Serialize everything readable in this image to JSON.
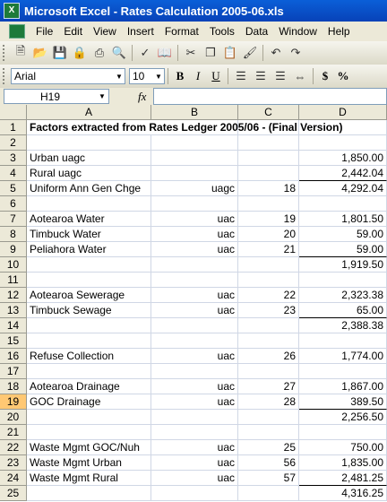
{
  "window": {
    "title": "Microsoft Excel - Rates Calculation 2005-06.xls",
    "icon_letter": "X"
  },
  "menu": [
    "File",
    "Edit",
    "View",
    "Insert",
    "Format",
    "Tools",
    "Data",
    "Window",
    "Help"
  ],
  "toolbar2": {
    "font": "Arial",
    "size": "10",
    "bold": "B",
    "italic": "I",
    "underline": "U",
    "currency": "$",
    "percent": "%"
  },
  "formula_bar": {
    "name_box": "H19",
    "fx": "fx",
    "content": ""
  },
  "columns": [
    "A",
    "B",
    "C",
    "D"
  ],
  "rows": [
    {
      "n": "1",
      "a": "Factors extracted from Rates Ledger 2005/06 - (Final Version)",
      "b": "",
      "c": "",
      "d": ""
    },
    {
      "n": "2",
      "a": "",
      "b": "",
      "c": "",
      "d": ""
    },
    {
      "n": "3",
      "a": "Urban uagc",
      "b": "",
      "c": "",
      "d": "1,850.00"
    },
    {
      "n": "4",
      "a": "Rural uagc",
      "b": "",
      "c": "",
      "d": "2,442.04"
    },
    {
      "n": "5",
      "a": "Uniform Ann Gen Chge",
      "b": "uagc",
      "c": "18",
      "d": "4,292.04"
    },
    {
      "n": "6",
      "a": "",
      "b": "",
      "c": "",
      "d": ""
    },
    {
      "n": "7",
      "a": "Aotearoa Water",
      "b": "uac",
      "c": "19",
      "d": "1,801.50"
    },
    {
      "n": "8",
      "a": "Timbuck Water",
      "b": "uac",
      "c": "20",
      "d": "59.00"
    },
    {
      "n": "9",
      "a": "Peliahora Water",
      "b": "uac",
      "c": "21",
      "d": "59.00"
    },
    {
      "n": "10",
      "a": "",
      "b": "",
      "c": "",
      "d": "1,919.50"
    },
    {
      "n": "11",
      "a": "",
      "b": "",
      "c": "",
      "d": ""
    },
    {
      "n": "12",
      "a": "Aotearoa Sewerage",
      "b": "uac",
      "c": "22",
      "d": "2,323.38"
    },
    {
      "n": "13",
      "a": "Timbuck Sewage",
      "b": "uac",
      "c": "23",
      "d": "65.00"
    },
    {
      "n": "14",
      "a": "",
      "b": "",
      "c": "",
      "d": "2,388.38"
    },
    {
      "n": "15",
      "a": "",
      "b": "",
      "c": "",
      "d": ""
    },
    {
      "n": "16",
      "a": "Refuse Collection",
      "b": "uac",
      "c": "26",
      "d": "1,774.00"
    },
    {
      "n": "17",
      "a": "",
      "b": "",
      "c": "",
      "d": ""
    },
    {
      "n": "18",
      "a": "Aotearoa Drainage",
      "b": "uac",
      "c": "27",
      "d": "1,867.00"
    },
    {
      "n": "19",
      "a": "GOC Drainage",
      "b": "uac",
      "c": "28",
      "d": "389.50"
    },
    {
      "n": "20",
      "a": "",
      "b": "",
      "c": "",
      "d": "2,256.50"
    },
    {
      "n": "21",
      "a": "",
      "b": "",
      "c": "",
      "d": ""
    },
    {
      "n": "22",
      "a": "Waste Mgmt GOC/Nuh",
      "b": "uac",
      "c": "25",
      "d": "750.00"
    },
    {
      "n": "23",
      "a": "Waste Mgmt Urban",
      "b": "uac",
      "c": "56",
      "d": "1,835.00"
    },
    {
      "n": "24",
      "a": "Waste Mgmt Rural",
      "b": "uac",
      "c": "57",
      "d": "2,481.25"
    },
    {
      "n": "25",
      "a": "",
      "b": "",
      "c": "",
      "d": "4,316.25"
    }
  ],
  "underline_rows": [
    "4",
    "9",
    "13",
    "19",
    "24"
  ],
  "selected_row": "19"
}
